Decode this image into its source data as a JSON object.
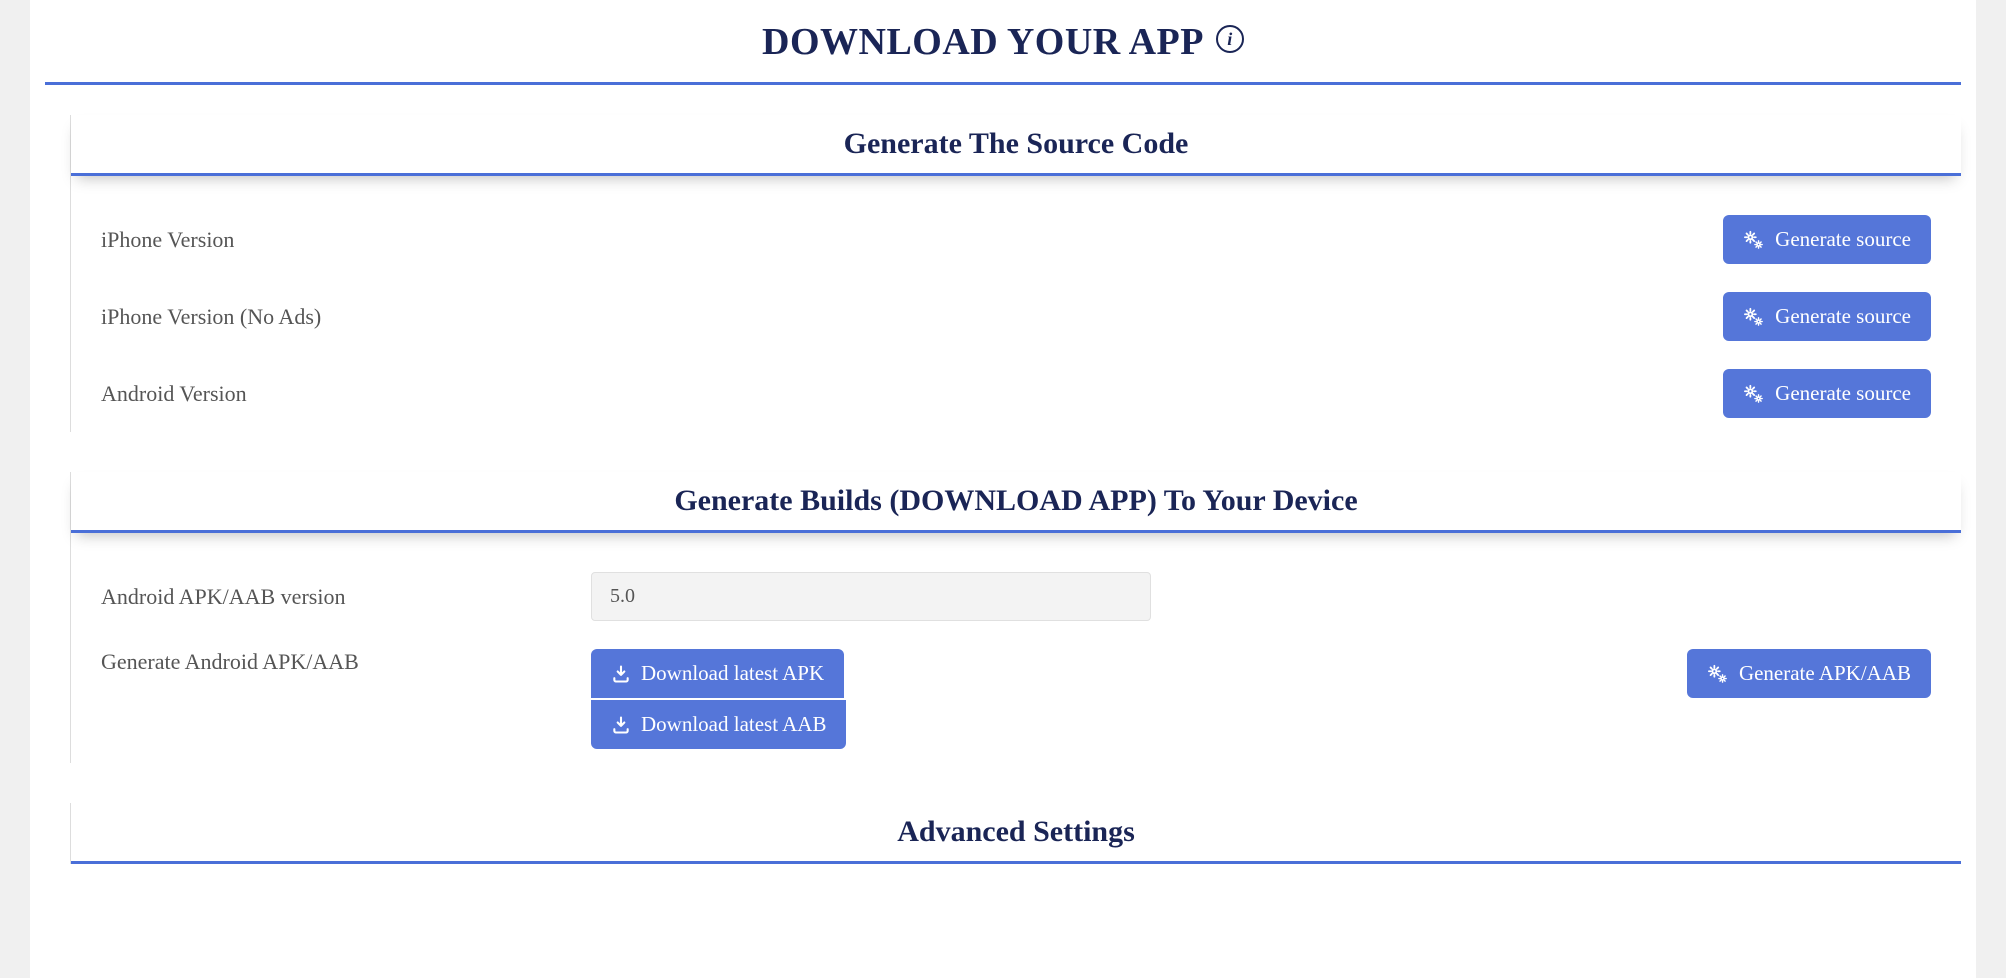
{
  "header": {
    "title": "DOWNLOAD YOUR APP",
    "info_glyph": "i"
  },
  "sections": {
    "source": {
      "title": "Generate The Source Code",
      "rows": [
        {
          "label": "iPhone Version",
          "button": "Generate source"
        },
        {
          "label": "iPhone Version (No Ads)",
          "button": "Generate source"
        },
        {
          "label": "Android Version",
          "button": "Generate source"
        }
      ]
    },
    "builds": {
      "title": "Generate Builds (DOWNLOAD APP) To Your Device",
      "version_label": "Android APK/AAB version",
      "version_value": "5.0",
      "generate_label": "Generate Android APK/AAB",
      "download_apk": "Download latest APK",
      "download_aab": "Download latest AAB",
      "generate_button": "Generate APK/AAB"
    },
    "advanced": {
      "title": "Advanced Settings"
    }
  }
}
